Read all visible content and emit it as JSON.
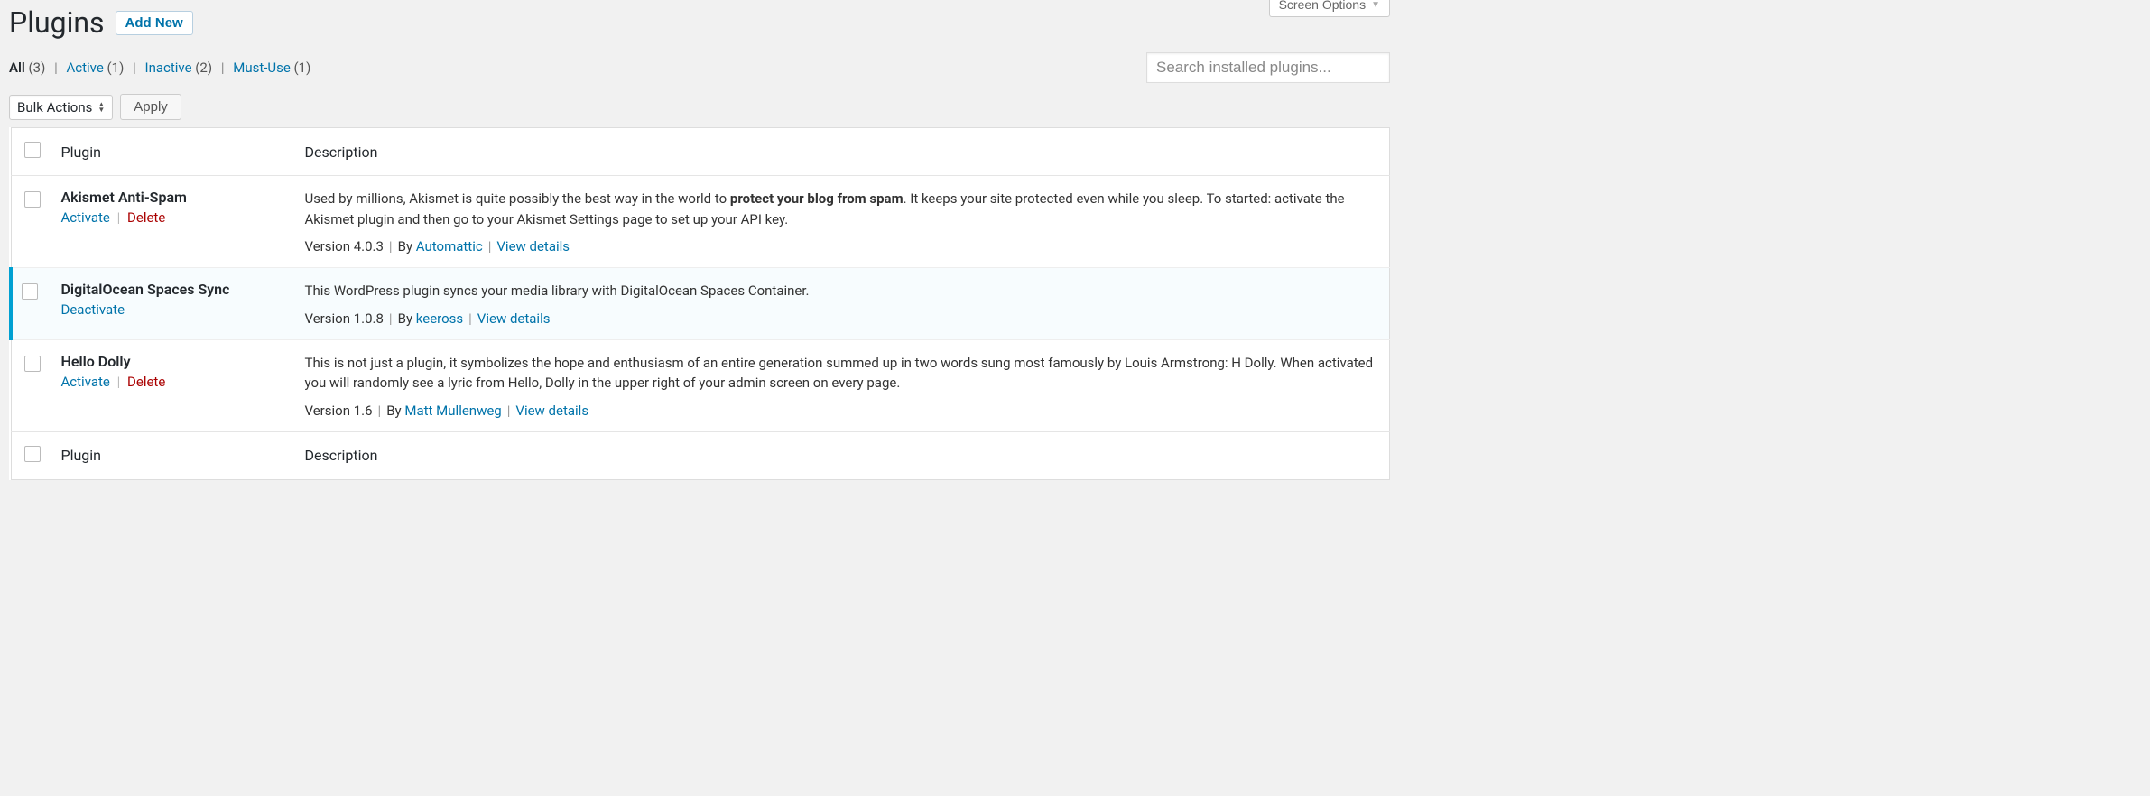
{
  "screen_options": "Screen Options",
  "page_title": "Plugins",
  "add_new": "Add New",
  "filters": {
    "all_label": "All",
    "all_count": "(3)",
    "active_label": "Active",
    "active_count": "(1)",
    "inactive_label": "Inactive",
    "inactive_count": "(2)",
    "mustuse_label": "Must-Use",
    "mustuse_count": "(1)"
  },
  "search_placeholder": "Search installed plugins...",
  "bulk_actions": "Bulk Actions",
  "apply": "Apply",
  "cols": {
    "plugin": "Plugin",
    "description": "Description"
  },
  "action": {
    "activate": "Activate",
    "deactivate": "Deactivate",
    "delete": "Delete",
    "view_details": "View details",
    "by": "By"
  },
  "plugins": {
    "akismet": {
      "name": "Akismet Anti-Spam",
      "desc_pre": "Used by millions, Akismet is quite possibly the best way in the world to ",
      "desc_bold": "protect your blog from spam",
      "desc_post": ". It keeps your site protected even while you sleep. To started: activate the Akismet plugin and then go to your Akismet Settings page to set up your API key.",
      "version": "Version 4.0.3",
      "author": "Automattic"
    },
    "dospaces": {
      "name": "DigitalOcean Spaces Sync",
      "desc": "This WordPress plugin syncs your media library with DigitalOcean Spaces Container.",
      "version": "Version 1.0.8",
      "author": "keeross"
    },
    "hello": {
      "name": "Hello Dolly",
      "desc": "This is not just a plugin, it symbolizes the hope and enthusiasm of an entire generation summed up in two words sung most famously by Louis Armstrong: H Dolly. When activated you will randomly see a lyric from Hello, Dolly in the upper right of your admin screen on every page.",
      "version": "Version 1.6",
      "author": "Matt Mullenweg"
    }
  }
}
